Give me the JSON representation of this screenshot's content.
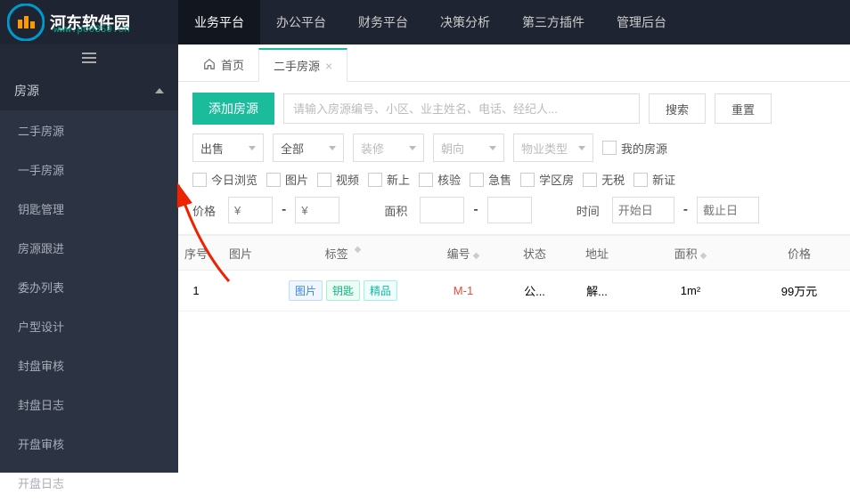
{
  "logo": {
    "text": "河东软件园",
    "url": "www.pc0359.cn"
  },
  "topnav": [
    {
      "label": "业务平台",
      "active": true
    },
    {
      "label": "办公平台",
      "active": false
    },
    {
      "label": "财务平台",
      "active": false
    },
    {
      "label": "决策分析",
      "active": false
    },
    {
      "label": "第三方插件",
      "active": false
    },
    {
      "label": "管理后台",
      "active": false
    }
  ],
  "sidebar": {
    "group": "房源",
    "items": [
      "二手房源",
      "一手房源",
      "钥匙管理",
      "房源跟进",
      "委办列表",
      "户型设计",
      "封盘审核",
      "封盘日志",
      "开盘审核",
      "开盘日志"
    ]
  },
  "tabs": [
    {
      "label": "首页",
      "home": true,
      "active": false
    },
    {
      "label": "二手房源",
      "active": true,
      "closable": true
    }
  ],
  "toolbar": {
    "add": "添加房源",
    "search_ph": "请输入房源编号、小区、业主姓名、电话、经纪人...",
    "search_btn": "搜索",
    "reset_btn": "重置",
    "selects": {
      "sale": "出售",
      "all": "全部",
      "deco": "装修",
      "orient": "朝向",
      "ptype": "物业类型"
    },
    "mine": "我的房源",
    "checks": [
      "今日浏览",
      "图片",
      "视频",
      "新上",
      "核验",
      "急售",
      "学区房",
      "无税",
      "新证"
    ],
    "price_label": "价格",
    "yen": "¥",
    "area_label": "面积",
    "time_label": "时间",
    "start": "开始日",
    "end": "截止日"
  },
  "table": {
    "headers": {
      "idx": "序号",
      "img": "图片",
      "tags": "标签",
      "code": "编号",
      "status": "状态",
      "addr": "地址",
      "area": "面积",
      "price": "价格"
    },
    "rows": [
      {
        "idx": "1",
        "tags": [
          {
            "t": "图片",
            "c": "blue"
          },
          {
            "t": "钥匙",
            "c": "green"
          },
          {
            "t": "精品",
            "c": "teal"
          }
        ],
        "code": "M-1",
        "status": "公...",
        "addr": "解...",
        "area": "1m²",
        "price": "99万元"
      }
    ]
  }
}
